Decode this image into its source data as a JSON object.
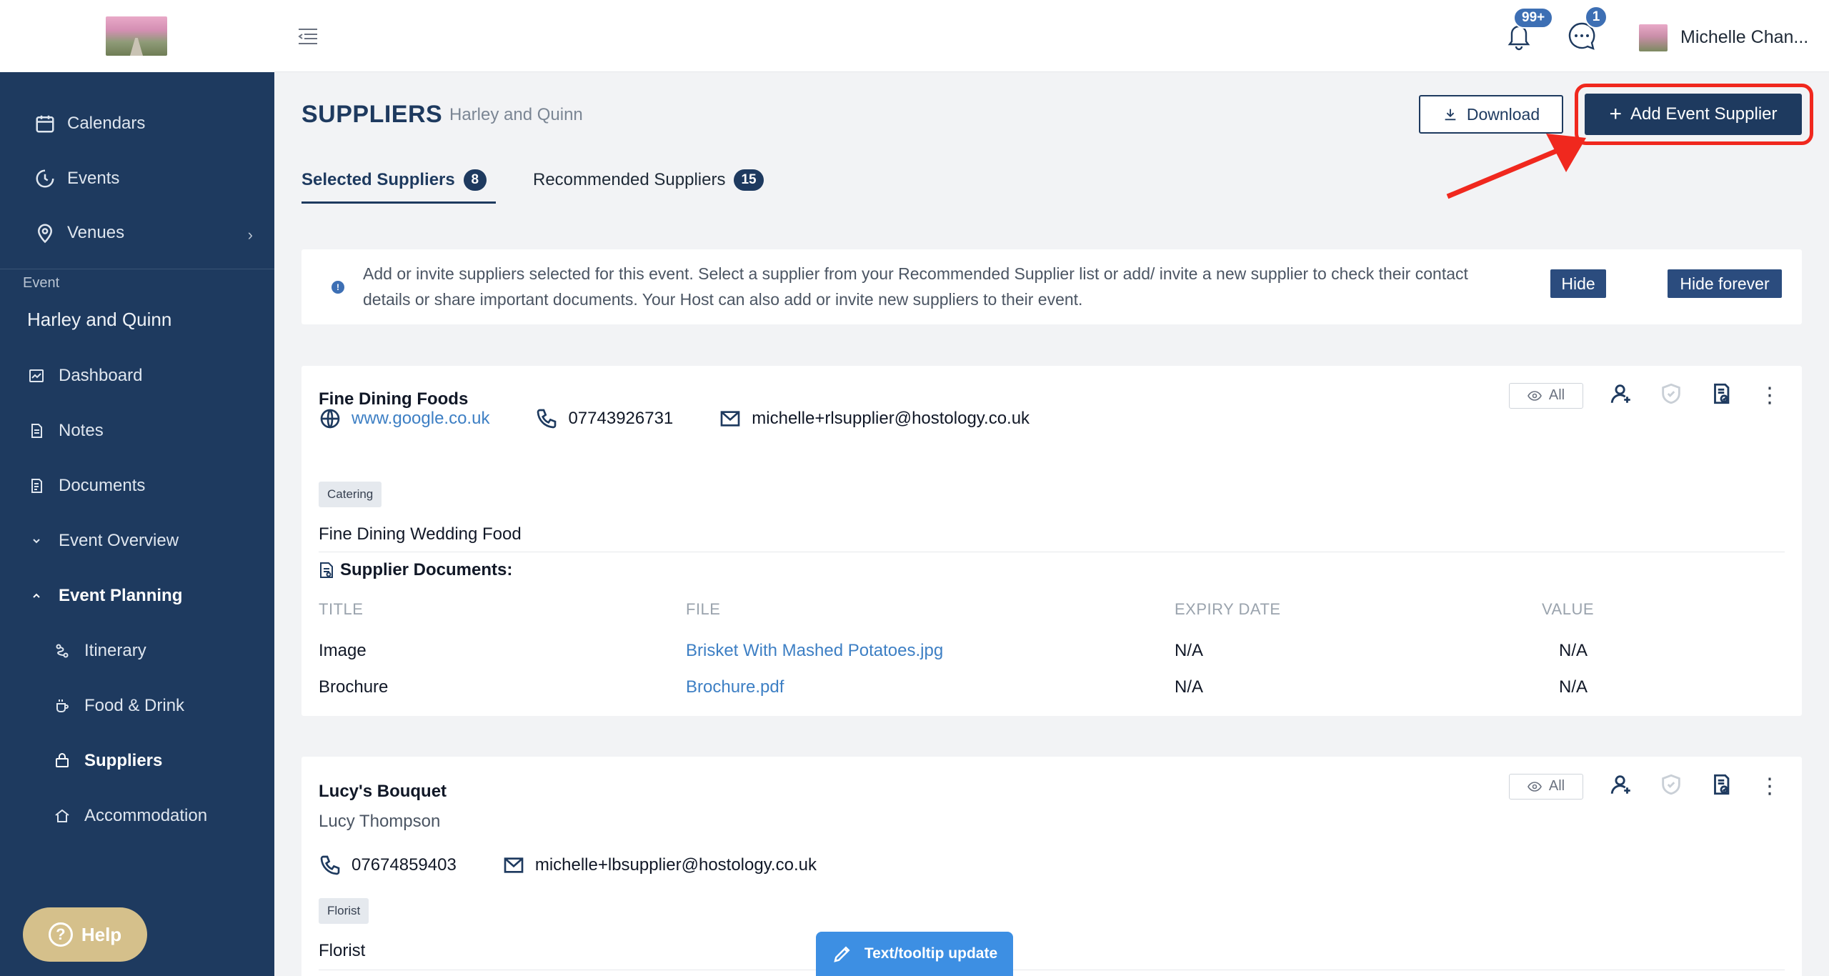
{
  "user": {
    "name": "Michelle Chan..."
  },
  "notifications": {
    "bell_count": "99+",
    "chat_count": "1"
  },
  "sidebar": {
    "top_items": [
      {
        "label": "Calendars",
        "icon": "calendar-icon"
      },
      {
        "label": "Events",
        "icon": "events-icon"
      },
      {
        "label": "Venues",
        "icon": "location-pin-icon",
        "chevron": "›"
      }
    ],
    "section_label": "Event",
    "event_name": "Harley and Quinn",
    "event_items": [
      {
        "label": "Dashboard",
        "icon": "dashboard-icon"
      },
      {
        "label": "Notes",
        "icon": "notes-icon"
      },
      {
        "label": "Documents",
        "icon": "documents-icon"
      },
      {
        "label": "Event Overview",
        "icon": "chevron-down-icon"
      },
      {
        "label": "Event Planning",
        "icon": "chevron-up-icon"
      }
    ],
    "planning_items": [
      {
        "label": "Itinerary",
        "icon": "itinerary-icon"
      },
      {
        "label": "Food & Drink",
        "icon": "coffee-icon"
      },
      {
        "label": "Suppliers",
        "icon": "suppliers-icon",
        "active": true
      },
      {
        "label": "Accommodation",
        "icon": "home-icon"
      }
    ],
    "help_label": "Help"
  },
  "page": {
    "title": "SUPPLIERS",
    "subtitle": "Harley and Quinn",
    "download_label": "Download",
    "add_label": "Add Event Supplier",
    "tabs": [
      {
        "label": "Selected Suppliers",
        "count": "8",
        "active": true
      },
      {
        "label": "Recommended Suppliers",
        "count": "15",
        "active": false
      }
    ],
    "info": {
      "text": "Add or invite suppliers selected for this event. Select a supplier from your Recommended Supplier list or add/ invite a new supplier to check their contact details or share important documents. Your Host can also add or invite new suppliers to their event.",
      "hide_label": "Hide",
      "hide_forever_label": "Hide forever"
    }
  },
  "suppliers": [
    {
      "name": "Fine Dining Foods",
      "visibility": "All",
      "website": "www.google.co.uk",
      "phone": "07743926731",
      "email": "michelle+rlsupplier@hostology.co.uk",
      "tag": "Catering",
      "description": "Fine Dining Wedding Food",
      "docs_title": "Supplier Documents:",
      "doc_headers": [
        "TITLE",
        "FILE",
        "EXPIRY DATE",
        "VALUE"
      ],
      "documents": [
        {
          "title": "Image",
          "file": "Brisket With Mashed Potatoes.jpg",
          "expiry": "N/A",
          "value": "N/A"
        },
        {
          "title": "Brochure",
          "file": "Brochure.pdf",
          "expiry": "N/A",
          "value": "N/A"
        }
      ]
    },
    {
      "name": "Lucy's Bouquet",
      "contact_person": "Lucy Thompson",
      "visibility": "All",
      "phone": "07674859403",
      "email": "michelle+lbsupplier@hostology.co.uk",
      "tag": "Florist",
      "description": "Florist"
    }
  ],
  "feedback_button": "Text/tooltip update",
  "colors": {
    "sidebar": "#1e3a5f",
    "accent": "#3d6fb4",
    "highlight": "#f0281e",
    "help": "#d5c08b"
  }
}
